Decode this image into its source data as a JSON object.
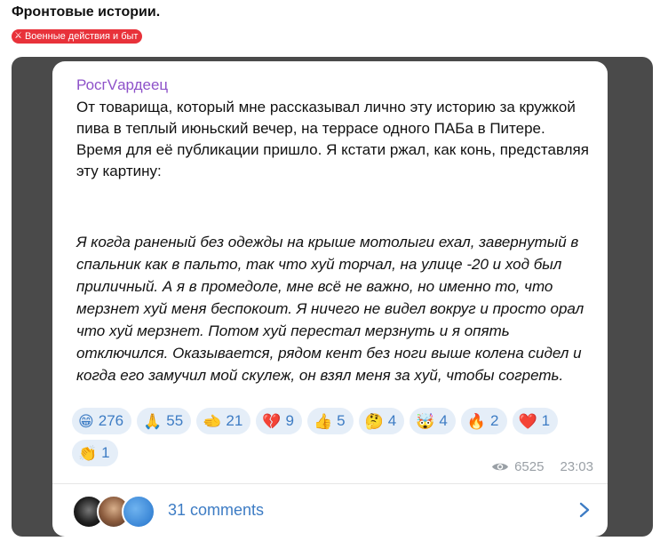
{
  "header": {
    "title": "Фронтовые истории.",
    "tag": {
      "icon": "crossed-swords-icon",
      "label": "Военные действия и быт",
      "color": "#e8323a"
    }
  },
  "post": {
    "author": "РосгVардеец",
    "intro": [
      "От товарища, который мне рассказывал лично эту историю за кружкой пива в теплый июньский вечер, на террасе одного ПАБа в Питере.",
      "Время для её публикации пришло. Я кстати ржал, как конь, представляя эту картину:"
    ],
    "quote": "Я когда раненый без одежды на крыше мотолыги ехал, завернутый в спальник как в пальто, так что хуй торчал, на улице -20 и ход был приличный. А я в промедоле, мне всё не важно, но именно то, что мерзнет хуй меня беспокоит. Я ничего не видел вокруг и просто орал что хуй мерзнет. Потом хуй перестал мерзнуть и я опять отключился. Оказывается, рядом кент без ноги выше колена сидел и когда его замучил мой скулеж, он взял меня за хуй, чтобы согреть.",
    "reactions": [
      {
        "emoji": "😁",
        "icon": "grinning-face-icon",
        "count": "276"
      },
      {
        "emoji": "🙏",
        "icon": "folded-hands-icon",
        "count": "55"
      },
      {
        "emoji": "🫲",
        "icon": "pointing-hand-icon",
        "count": "21"
      },
      {
        "emoji": "💔",
        "icon": "broken-heart-icon",
        "count": "9"
      },
      {
        "emoji": "👍",
        "icon": "thumbs-up-icon",
        "count": "5"
      },
      {
        "emoji": "🤔",
        "icon": "thinking-face-icon",
        "count": "4"
      },
      {
        "emoji": "🤯",
        "icon": "exploding-head-icon",
        "count": "4"
      },
      {
        "emoji": "🔥",
        "icon": "fire-icon",
        "count": "2"
      },
      {
        "emoji": "❤️",
        "icon": "red-heart-icon",
        "count": "1"
      },
      {
        "emoji": "👏",
        "icon": "clapping-hands-icon",
        "count": "1"
      }
    ],
    "views": "6525",
    "time": "23:03",
    "comments_label": "31 comments"
  },
  "colors": {
    "accent": "#3d7cc4",
    "author": "#8e52c9",
    "panel": "#4a4a4a",
    "reaction_bg": "#e5eef8"
  }
}
